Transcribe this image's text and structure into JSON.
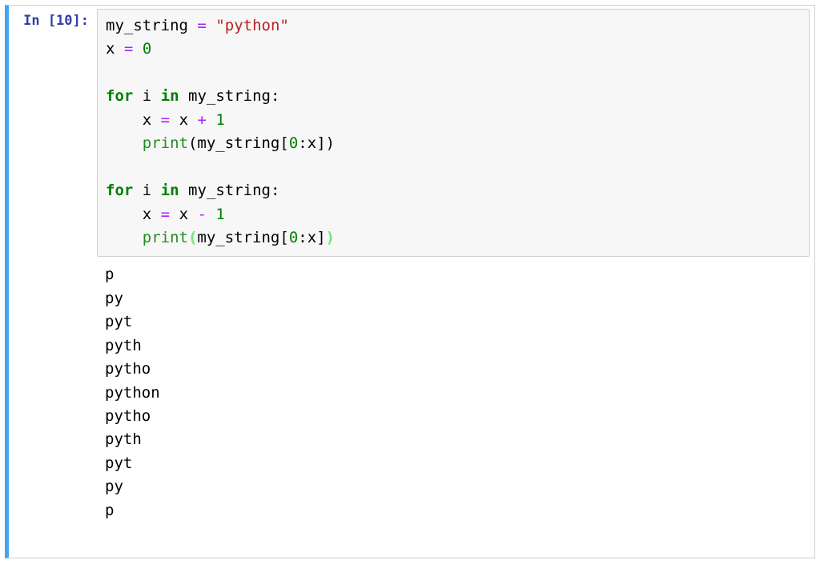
{
  "prompt": {
    "label": "In [10]:"
  },
  "code": {
    "l1": {
      "v1": "my_string",
      "op": "=",
      "str": "\"python\""
    },
    "l2": {
      "v1": "x",
      "op": "=",
      "num": "0"
    },
    "l4": {
      "kw1": "for",
      "v1": "i",
      "kw2": "in",
      "v2": "my_string",
      "colon": ":"
    },
    "l5": {
      "v1": "x",
      "op1": "=",
      "v2": "x",
      "op2": "+",
      "num": "1"
    },
    "l6": {
      "fn": "print",
      "lpar": "(",
      "v1": "my_string",
      "lbrk": "[",
      "num": "0",
      "colon": ":",
      "v2": "x",
      "rbrk": "]",
      "rpar": ")"
    },
    "l8": {
      "kw1": "for",
      "v1": "i",
      "kw2": "in",
      "v2": "my_string",
      "colon": ":"
    },
    "l9": {
      "v1": "x",
      "op1": "=",
      "v2": "x",
      "op2": "-",
      "num": "1"
    },
    "l10": {
      "fn": "print",
      "lpar": "(",
      "v1": "my_string",
      "lbrk": "[",
      "num": "0",
      "colon": ":",
      "v2": "x",
      "rbrk": "]",
      "rpar": ")"
    }
  },
  "output_lines": [
    "p",
    "py",
    "pyt",
    "pyth",
    "pytho",
    "python",
    "pytho",
    "pyth",
    "pyt",
    "py",
    "p"
  ]
}
